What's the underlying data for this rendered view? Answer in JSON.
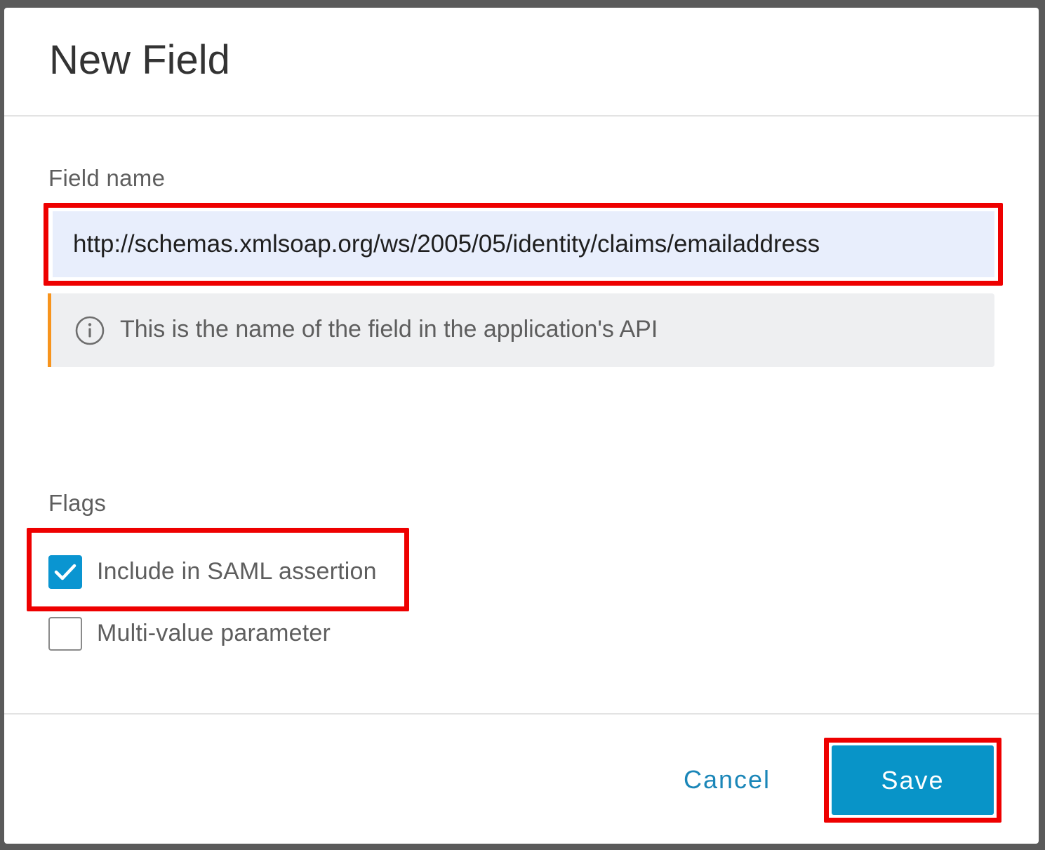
{
  "dialog": {
    "title": "New Field",
    "field_name": {
      "label": "Field name",
      "value": "http://schemas.xmlsoap.org/ws/2005/05/identity/claims/emailaddress",
      "hint": {
        "icon": "info-circle-icon",
        "text": "This is the name of the field in the application's API"
      }
    },
    "flags": {
      "label": "Flags",
      "items": [
        {
          "label": "Include in SAML assertion",
          "checked": true
        },
        {
          "label": "Multi-value parameter",
          "checked": false
        }
      ]
    },
    "footer": {
      "cancel_label": "Cancel",
      "save_label": "Save"
    }
  },
  "colors": {
    "primary": "#0894c8",
    "link": "#1a86b8",
    "hint_accent": "#f7941d",
    "highlight": "#ee0000",
    "input_bg": "#e8eefc",
    "overlay": "#5a5a5a"
  }
}
